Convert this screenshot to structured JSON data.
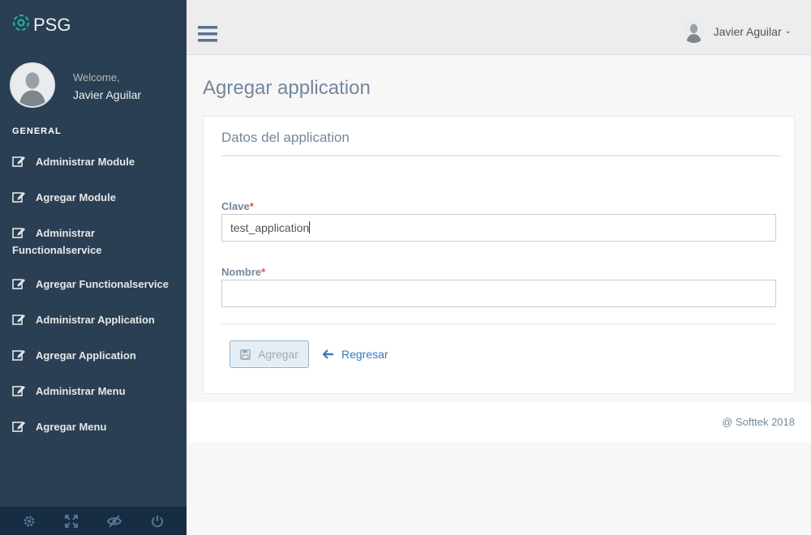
{
  "brand": {
    "name": "PSG"
  },
  "sidebar": {
    "welcome": "Welcome,",
    "user_name": "Javier Aguilar",
    "section_title": "GENERAL",
    "items": [
      {
        "label": "Administrar Module"
      },
      {
        "label": "Agregar Module"
      },
      {
        "label": "Administrar Functionalservice"
      },
      {
        "label": "Agregar Functionalservice"
      },
      {
        "label": "Administrar Application"
      },
      {
        "label": "Agregar Application"
      },
      {
        "label": "Administrar Menu"
      },
      {
        "label": "Agregar Menu"
      }
    ],
    "footer_icons": [
      "gear-icon",
      "fullscreen-icon",
      "eye-slash-icon",
      "power-icon"
    ]
  },
  "topnav": {
    "user_name": "Javier Aguilar",
    "chevron": "⌄"
  },
  "page": {
    "title": "Agregar application"
  },
  "panel": {
    "title": "Datos del application",
    "fields": {
      "clave": {
        "label": "Clave",
        "required_mark": "*",
        "value": "test_application"
      },
      "nombre": {
        "label": "Nombre",
        "required_mark": "*",
        "value": ""
      }
    },
    "add_label": "Agregar",
    "back_label": "Regresar"
  },
  "footer": {
    "text": "@ Softtek 2018"
  },
  "colors": {
    "sidebar_bg": "#2a3f54",
    "accent": "#337ab7",
    "title": "#73879C",
    "required": "#d9534f"
  }
}
